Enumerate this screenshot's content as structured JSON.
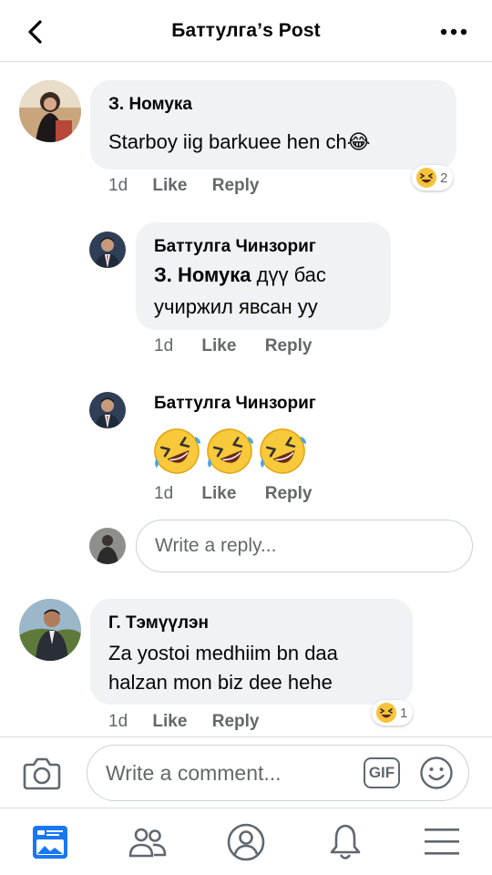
{
  "header": {
    "title": "Баттулга’s Post"
  },
  "comments": [
    {
      "author": "З. Номука",
      "text": "Starboy iig barkuee hen ch😂",
      "age": "1d",
      "like": "Like",
      "reply": "Reply",
      "reaction_count": "2",
      "replies": [
        {
          "author": "Баттулга Чинзориг",
          "mention": "З. Номука",
          "text_line1_rest": " дүү бас",
          "text_line2": "учиржил явсан уу",
          "age": "1d",
          "like": "Like",
          "reply": "Reply"
        },
        {
          "author": "Баттулга Чинзориг",
          "emoji_count": 3,
          "age": "1d",
          "like": "Like",
          "reply": "Reply"
        }
      ]
    },
    {
      "author": "Г. Тэмүүлэн",
      "text_line1": "Za yostoi medhiim bn daa",
      "text_line2": "halzan mon biz dee hehe",
      "age": "1d",
      "like": "Like",
      "reply": "Reply",
      "reaction_count": "1"
    }
  ],
  "reply_input": {
    "placeholder": "Write a reply..."
  },
  "composer": {
    "placeholder": "Write a comment...",
    "gif_label": "GIF"
  },
  "tabs": [
    "news-feed",
    "friends",
    "profile",
    "notifications",
    "menu"
  ],
  "colors": {
    "accent": "#1877f2",
    "bubble": "#f0f2f5",
    "meta": "#65676b"
  }
}
